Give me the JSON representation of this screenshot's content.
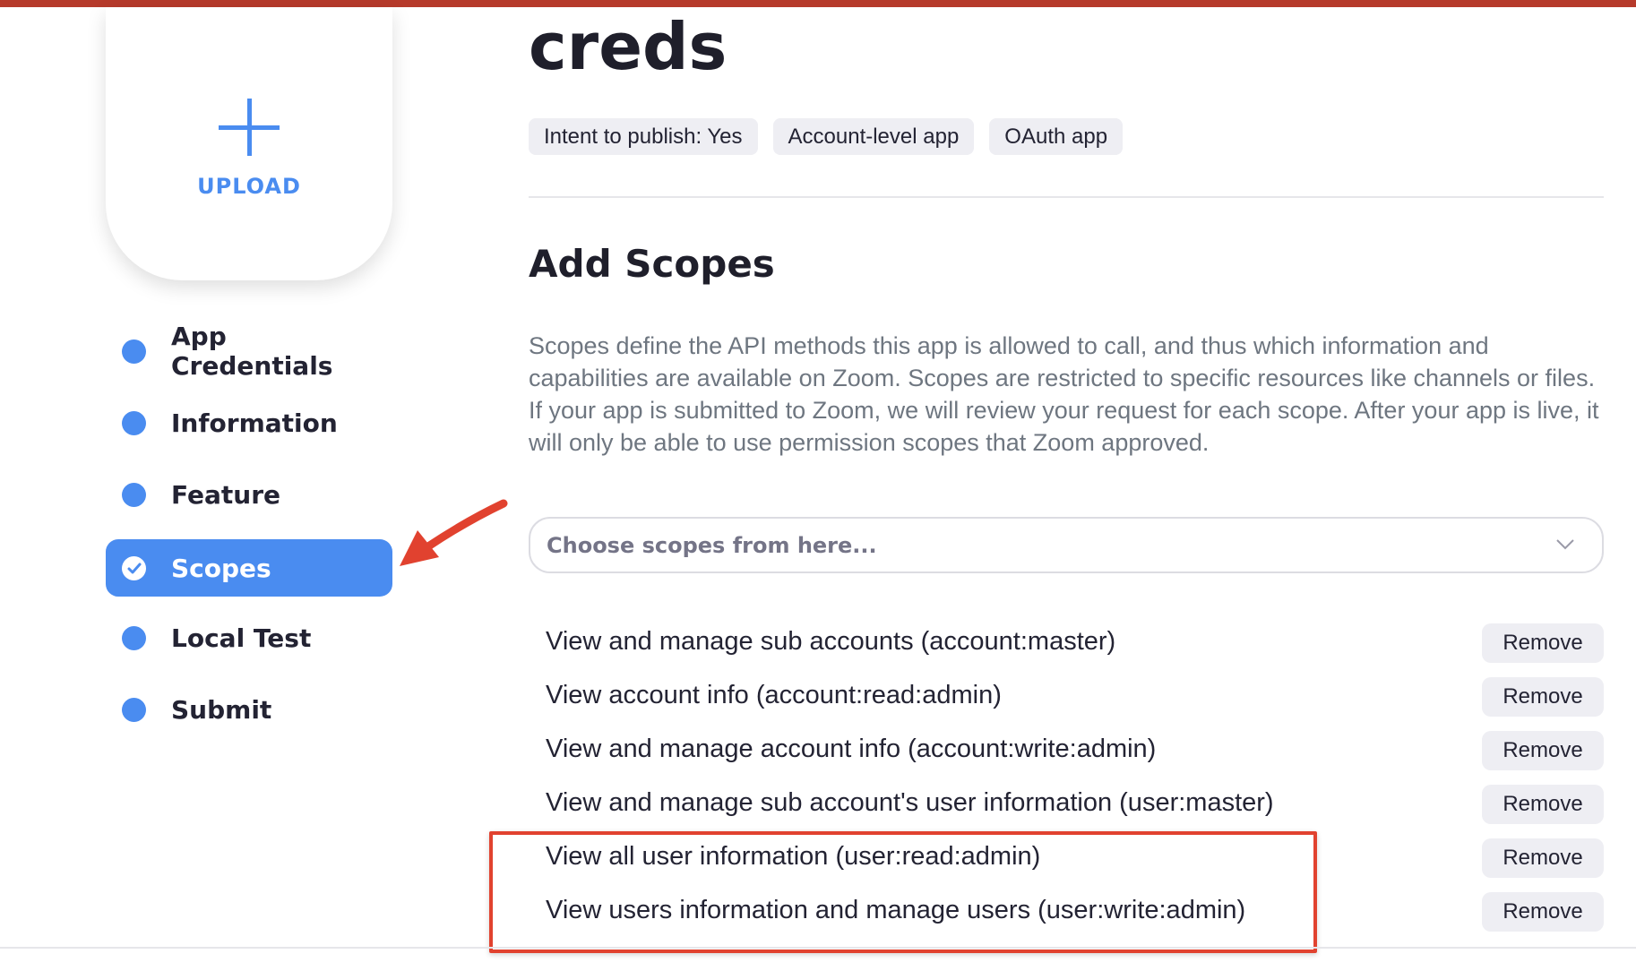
{
  "upload": {
    "label": "UPLOAD",
    "icon": "plus-icon"
  },
  "sidebar": {
    "items": [
      {
        "label": "App Credentials",
        "active": false
      },
      {
        "label": "Information",
        "active": false
      },
      {
        "label": "Feature",
        "active": false
      },
      {
        "label": "Scopes",
        "active": true
      },
      {
        "label": "Local Test",
        "active": false
      },
      {
        "label": "Submit",
        "active": false
      }
    ]
  },
  "header": {
    "title": "creds",
    "tags": [
      "Intent to publish: Yes",
      "Account-level app",
      "OAuth app"
    ]
  },
  "scopes_section": {
    "title": "Add Scopes",
    "description": "Scopes define the API methods this app is allowed to call, and thus which information and capabilities are available on Zoom. Scopes are restricted to specific resources like channels or files. If your app is submitted to Zoom, we will review your request for each scope. After your app is live, it will only be able to use permission scopes that Zoom approved.",
    "select_placeholder": "Choose scopes from here...",
    "remove_label": "Remove",
    "scopes": [
      "View and manage sub accounts (account:master)",
      "View account info (account:read:admin)",
      "View and manage account info (account:write:admin)",
      "View and manage sub account's user information (user:master)",
      "View all user information (user:read:admin)",
      "View users information and manage users (user:write:admin)"
    ]
  },
  "colors": {
    "accent": "#4a8cf0",
    "annotation": "#e1422f",
    "top_bar": "#b63a2b"
  }
}
